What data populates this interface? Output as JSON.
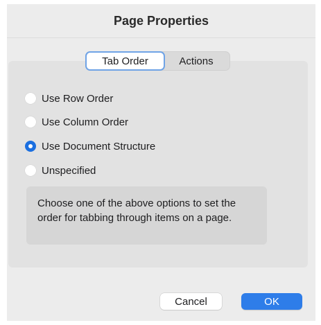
{
  "dialog": {
    "title": "Page Properties"
  },
  "tabs": [
    {
      "label": "Tab Order",
      "active": true
    },
    {
      "label": "Actions",
      "active": false
    }
  ],
  "options": [
    {
      "label": "Use Row Order",
      "selected": false
    },
    {
      "label": "Use Column Order",
      "selected": false
    },
    {
      "label": "Use Document Structure",
      "selected": true
    },
    {
      "label": "Unspecified",
      "selected": false
    }
  ],
  "help_text": "Choose one of the above options to set the order for tabbing through items on a page.",
  "buttons": {
    "cancel": "Cancel",
    "ok": "OK"
  },
  "colors": {
    "accent": "#2e7de9",
    "radio_selected": "#1b6fe0",
    "background": "#ececec"
  }
}
